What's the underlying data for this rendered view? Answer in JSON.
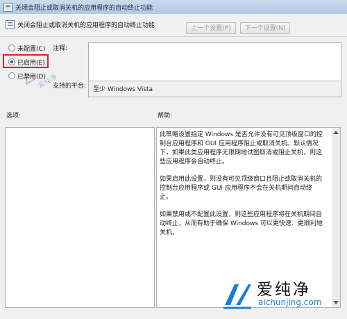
{
  "window": {
    "title": "关闭会阻止或取消关机的应用程序的自动终止功能"
  },
  "header": {
    "policy_title": "关闭会阻止或取消关机的应用程序的自动终止功能",
    "prev_button": "上一个设置(P)",
    "next_button": "下一个设置(N)"
  },
  "state_options": [
    {
      "label": "未配置(C)",
      "checked": false
    },
    {
      "label": "已启用(E)",
      "checked": true
    },
    {
      "label": "已禁用(D)",
      "checked": false
    }
  ],
  "comment": {
    "label": "注释:",
    "value": ""
  },
  "supported_on": {
    "label": "支持的平台:",
    "value": "至少 Windows Vista"
  },
  "options": {
    "label": "选项:"
  },
  "help": {
    "label": "帮助:",
    "paragraphs": [
      "此策略设置指定 Windows 是否允许没有可见顶级窗口的控制台应用程序和 GUI 应用程序阻止或取消关机。默认情况下，如果此类应用程序无限期地试图取消或阻止关机，则这些应用程序会自动终止。",
      "如果启用此设置，则没有可见顶级窗口且阻止或取消关机的控制台应用程序或 GUI 应用程序不会在关机期间自动终止。",
      "如果禁用或不配置此设置，则这些应用程序将在关机期间自动终止，从而有助于确保 Windows 可以更快速、更顺利地关机。"
    ]
  },
  "watermark": {
    "left_text": "爱纯净",
    "brand_cn": "爱纯净",
    "brand_en": "aichunjing.com",
    "color": "#1b7dd8"
  },
  "colors": {
    "highlight": "#e02020",
    "titlebar": "#b1c9e6"
  }
}
